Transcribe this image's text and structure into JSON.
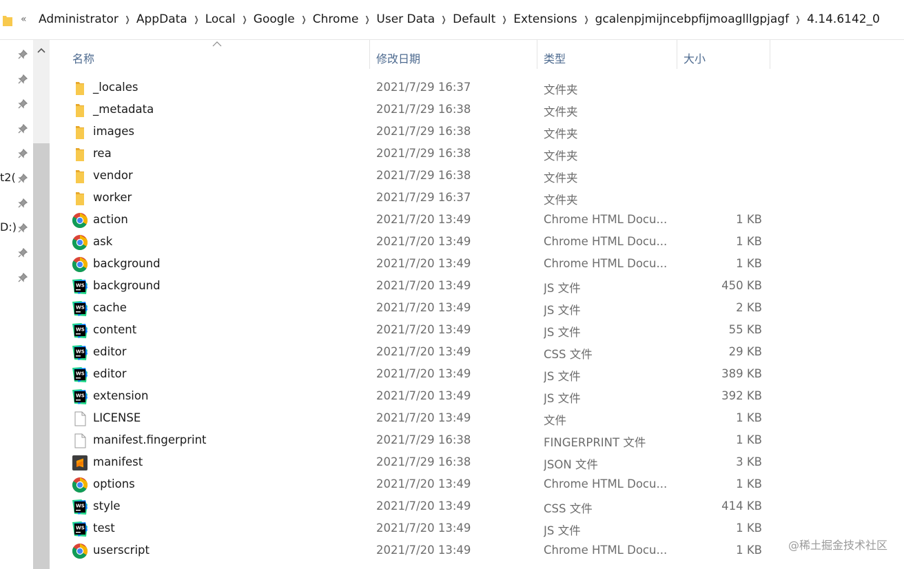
{
  "breadcrumb": {
    "overflow": "«",
    "items": [
      "Administrator",
      "AppData",
      "Local",
      "Google",
      "Chrome",
      "User Data",
      "Default",
      "Extensions",
      "gcalenpjmijncebpfijmoaglllgpjagf",
      "4.14.6142_0"
    ]
  },
  "nav": {
    "partial_labels": [
      "t2(",
      "D:)"
    ]
  },
  "columns": {
    "name": "名称",
    "date": "修改日期",
    "type": "类型",
    "size": "大小"
  },
  "files": [
    {
      "icon": "folder-icon",
      "name": "_locales",
      "date": "2021/7/29 16:37",
      "type": "文件夹",
      "size": ""
    },
    {
      "icon": "folder-icon",
      "name": "_metadata",
      "date": "2021/7/29 16:38",
      "type": "文件夹",
      "size": ""
    },
    {
      "icon": "folder-icon",
      "name": "images",
      "date": "2021/7/29 16:38",
      "type": "文件夹",
      "size": ""
    },
    {
      "icon": "folder-icon",
      "name": "rea",
      "date": "2021/7/29 16:38",
      "type": "文件夹",
      "size": ""
    },
    {
      "icon": "folder-icon",
      "name": "vendor",
      "date": "2021/7/29 16:38",
      "type": "文件夹",
      "size": ""
    },
    {
      "icon": "folder-icon",
      "name": "worker",
      "date": "2021/7/29 16:37",
      "type": "文件夹",
      "size": ""
    },
    {
      "icon": "chrome-icon",
      "name": "action",
      "date": "2021/7/20 13:49",
      "type": "Chrome HTML Docu...",
      "size": "1 KB"
    },
    {
      "icon": "chrome-icon",
      "name": "ask",
      "date": "2021/7/20 13:49",
      "type": "Chrome HTML Docu...",
      "size": "1 KB"
    },
    {
      "icon": "chrome-icon",
      "name": "background",
      "date": "2021/7/20 13:49",
      "type": "Chrome HTML Docu...",
      "size": "1 KB"
    },
    {
      "icon": "webstorm-icon",
      "name": "background",
      "date": "2021/7/20 13:49",
      "type": "JS 文件",
      "size": "450 KB"
    },
    {
      "icon": "webstorm-icon",
      "name": "cache",
      "date": "2021/7/20 13:49",
      "type": "JS 文件",
      "size": "2 KB"
    },
    {
      "icon": "webstorm-icon",
      "name": "content",
      "date": "2021/7/20 13:49",
      "type": "JS 文件",
      "size": "55 KB"
    },
    {
      "icon": "webstorm-icon",
      "name": "editor",
      "date": "2021/7/20 13:49",
      "type": "CSS 文件",
      "size": "29 KB"
    },
    {
      "icon": "webstorm-icon",
      "name": "editor",
      "date": "2021/7/20 13:49",
      "type": "JS 文件",
      "size": "389 KB"
    },
    {
      "icon": "webstorm-icon",
      "name": "extension",
      "date": "2021/7/20 13:49",
      "type": "JS 文件",
      "size": "392 KB"
    },
    {
      "icon": "blank-file-icon",
      "name": "LICENSE",
      "date": "2021/7/20 13:49",
      "type": "文件",
      "size": "1 KB"
    },
    {
      "icon": "blank-file-icon",
      "name": "manifest.fingerprint",
      "date": "2021/7/29 16:38",
      "type": "FINGERPRINT 文件",
      "size": "1 KB"
    },
    {
      "icon": "sublime-icon",
      "name": "manifest",
      "date": "2021/7/29 16:38",
      "type": "JSON 文件",
      "size": "3 KB"
    },
    {
      "icon": "chrome-icon",
      "name": "options",
      "date": "2021/7/20 13:49",
      "type": "Chrome HTML Docu...",
      "size": "1 KB"
    },
    {
      "icon": "webstorm-icon",
      "name": "style",
      "date": "2021/7/20 13:49",
      "type": "CSS 文件",
      "size": "414 KB"
    },
    {
      "icon": "webstorm-icon",
      "name": "test",
      "date": "2021/7/20 13:49",
      "type": "JS 文件",
      "size": "1 KB"
    },
    {
      "icon": "chrome-icon",
      "name": "userscript",
      "date": "2021/7/20 13:49",
      "type": "Chrome HTML Docu...",
      "size": "1 KB"
    }
  ],
  "watermark": "@稀土掘金技术社区",
  "colors": {
    "folder": "#f8c94d",
    "header_text": "#4d6a8f",
    "secondary_text": "#6d6d6d",
    "scrollbar_track": "#f0f0f0",
    "scrollbar_thumb": "#cdcdcd"
  }
}
